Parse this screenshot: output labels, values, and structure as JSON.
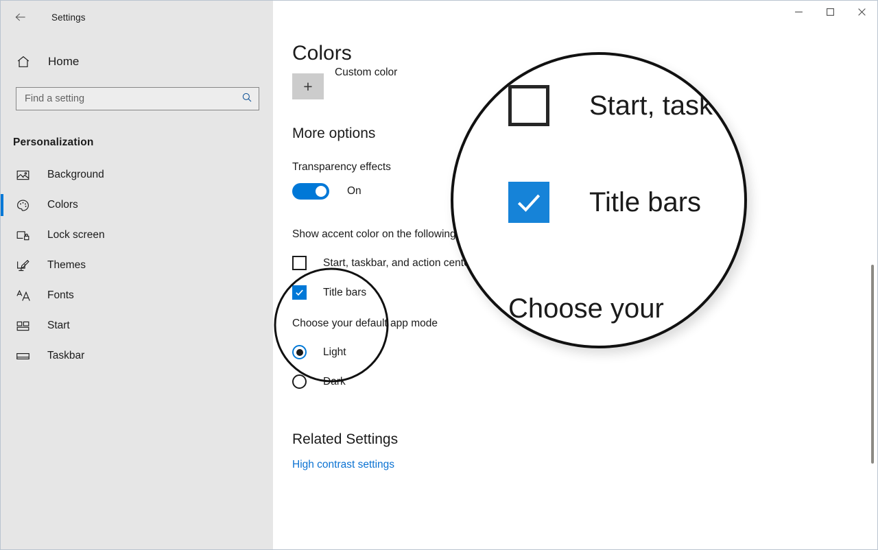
{
  "window": {
    "title": "Settings",
    "back_icon": "back-arrow-icon",
    "minimize_label": "─",
    "maximize_label": "☐",
    "close_label": "✕"
  },
  "sidebar": {
    "home_label": "Home",
    "home_icon": "home-icon",
    "search": {
      "placeholder": "Find a setting",
      "value": "",
      "icon": "search-icon"
    },
    "section_title": "Personalization",
    "items": [
      {
        "label": "Background",
        "icon": "image-icon",
        "selected": false
      },
      {
        "label": "Colors",
        "icon": "palette-icon",
        "selected": true
      },
      {
        "label": "Lock screen",
        "icon": "lock-screen-icon",
        "selected": false
      },
      {
        "label": "Themes",
        "icon": "themes-icon",
        "selected": false
      },
      {
        "label": "Fonts",
        "icon": "fonts-icon",
        "selected": false
      },
      {
        "label": "Start",
        "icon": "start-icon",
        "selected": false
      },
      {
        "label": "Taskbar",
        "icon": "taskbar-icon",
        "selected": false
      }
    ]
  },
  "main": {
    "page_title": "Colors",
    "custom_color": {
      "label": "Custom color",
      "plus_glyph": "+"
    },
    "more_options_title": "More options",
    "transparency": {
      "label": "Transparency effects",
      "state": "On",
      "enabled": true
    },
    "accent_surfaces": {
      "label": "Show accent color on the following surfaces",
      "checkboxes": [
        {
          "label": "Start, taskbar, and action center",
          "checked": false
        },
        {
          "label": "Title bars",
          "checked": true
        }
      ]
    },
    "app_mode": {
      "label": "Choose your default app mode",
      "options": [
        {
          "label": "Light",
          "selected": true
        },
        {
          "label": "Dark",
          "selected": false
        }
      ]
    },
    "related": {
      "title": "Related Settings",
      "link_label": "High contrast settings"
    }
  },
  "annotations": {
    "highlight_circle": {
      "shape": "circle",
      "encloses": "Title bars checkbox and Start, taskbar, and action center checkbox"
    },
    "magnifier": {
      "shape": "circle-lens",
      "rows": [
        {
          "label": "Start, task",
          "checked": false
        },
        {
          "label": "Title bars",
          "checked": true
        }
      ],
      "bottom_text": "Choose your"
    }
  },
  "colors": {
    "accent": "#0078d7",
    "sidebar_bg": "#e6e6e6",
    "content_bg": "#ffffff",
    "link": "#0b72d2",
    "text": "#1b1b1b"
  }
}
